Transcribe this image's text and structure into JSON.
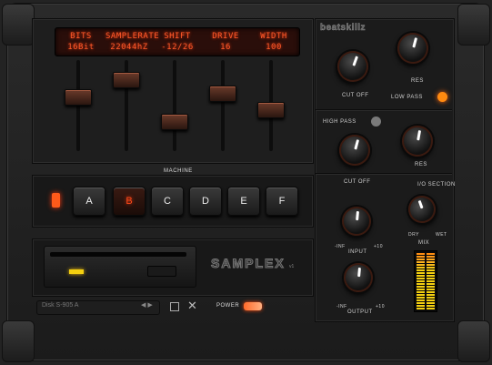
{
  "lcd": {
    "columns": [
      {
        "title": "BITS",
        "value": "16Bit"
      },
      {
        "title": "SAMPLERATE",
        "value": "22044hZ"
      },
      {
        "title": "SHIFT",
        "value": "-12/26"
      },
      {
        "title": "DRIVE",
        "value": "16"
      },
      {
        "title": "WIDTH",
        "value": "100"
      }
    ]
  },
  "sliders": {
    "levels": [
      0.62,
      0.85,
      0.3,
      0.67,
      0.45
    ]
  },
  "machine": {
    "label": "MACHINE",
    "buttons": [
      "A",
      "B",
      "C",
      "D",
      "E",
      "F"
    ],
    "active": "B"
  },
  "disk": {
    "logo": "SAMPLEX",
    "version": "v1",
    "preset_name": "Disk S-905 A",
    "preset_arrows": "◀ ▶",
    "close_symbol": "✕"
  },
  "power": {
    "label": "POWER"
  },
  "filter": {
    "brand": "beatskillz",
    "low_pass": {
      "cutoff_label": "CUT OFF",
      "res_label": "RES",
      "switch_label": "LOW PASS"
    },
    "high_pass": {
      "cutoff_label": "CUT OFF",
      "res_label": "RES",
      "switch_label": "HIGH PASS"
    }
  },
  "io": {
    "section_label": "I/O SECTION",
    "input_label": "INPUT",
    "input_min": "-INF",
    "input_max": "+10",
    "output_label": "OUTPUT",
    "output_min": "-INF",
    "output_max": "+10",
    "mix_label": "MIX",
    "mix_dry": "DRY",
    "mix_wet": "WET"
  },
  "colors": {
    "accent": "#ff5a2a",
    "led_amber": "#f4d010",
    "knob_ring": "#3a1a10"
  }
}
